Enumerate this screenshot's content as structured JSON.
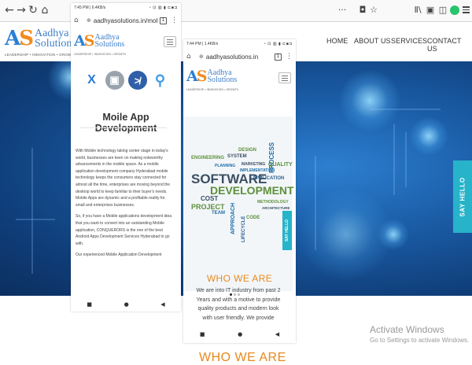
{
  "browser": {
    "back": "←",
    "forward": "→",
    "reload": "↻",
    "home": "⌂",
    "more": "···",
    "pocket": "◘",
    "bookmark": "☆",
    "library": "Ⅱ\\",
    "sidebar": "▣",
    "reader": "◫"
  },
  "brand": {
    "mark_a": "A",
    "mark_s": "S",
    "name_line1": "Aadhya",
    "name_line2": "Solutions",
    "tagline": "LEADERSHIP • INNOVATION • GROWTH"
  },
  "nav": {
    "items": [
      "HOME",
      "ABOUT US",
      "SERVICES",
      "CONTACT US"
    ]
  },
  "hero": {
    "say_hello": "SAY HELLO"
  },
  "windows": {
    "activate_title": "Activate Windows",
    "activate_sub": "Go to Settings to activate Windows."
  },
  "phone1": {
    "status_time": "7:45 PM | 6.4KB/s",
    "status_icons": "◔ ⊡ ▥ ▮ ⊏■⊐",
    "url": "aadhyasolutions.in/mob",
    "tabs": "1",
    "tech_icons": [
      "X",
      "▣",
      "≯",
      "⚲"
    ],
    "title": "Moile App Development",
    "paragraphs": [
      "With Mobile technology taking center stage in today's world, businesses are keen on making noteworthy advancements in the mobile space. As a mobile application development company Hyderabad mobile technology keeps the consumers stay connected for almost all the time, enterprises are moving beyond the desktop world to keep familiar to their buyer's needs. Mobile Apps are dynamic and a profitable reality for small and enterprises businesses.",
      "So, if you have a Mobile applications development idea that you want to convert into an outstanding Mobile application, CONQUERORS is the one of the best Android Apps Development Services Hyderabad to go with.",
      "Our experienced Mobile Application Development"
    ],
    "nav_buttons": [
      "■",
      "●",
      "◀"
    ]
  },
  "phone2": {
    "status_time": "7:44 PM | 1.4KB/s",
    "status_icons": "◔ ⊡ ▥ ▮ ⊏■⊐",
    "url": "aadhyasolutions.in",
    "tabs": "1",
    "wordcloud": {
      "software": "SOFTWARE",
      "development": "DEVELOPMENT",
      "process": "PROCESS",
      "quality": "QUALITY",
      "application": "APPLICATION",
      "project": "PROJECT",
      "engineering": "ENGINEERING",
      "approach": "APPROACH",
      "lifecycle": "LIFECYCLE",
      "cost": "COST",
      "methodology": "METHODOLOGY",
      "implementation": "IMPLEMENTATION",
      "system": "SYSTEM",
      "design": "DESIGN",
      "architecture": "ARCHITECTURE",
      "team": "TEAM",
      "code": "CODE",
      "marketing": "MARKETING",
      "planning": "PLANNING"
    },
    "say_hello": "SAY HELLO",
    "who_title": "WHO WE ARE",
    "who_body": "We are into IT industry from past 2 Years and with a motive to provide quality products and modern look with user friendly. We provide",
    "nav_buttons": [
      "■",
      "●",
      "◀"
    ]
  },
  "below_fold": {
    "who_title": "WHO WE ARE"
  }
}
